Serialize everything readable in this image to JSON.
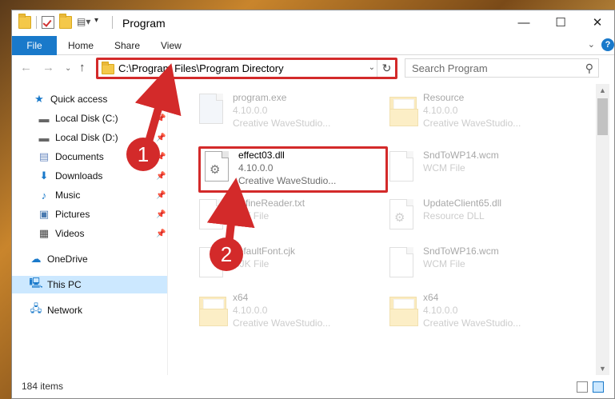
{
  "window": {
    "title": "Program",
    "controls": {
      "minimize": "—",
      "maximize": "☐",
      "close": "✕"
    }
  },
  "ribbon": {
    "tabs": [
      "File",
      "Home",
      "Share",
      "View"
    ],
    "help": "?"
  },
  "nav": {
    "address": "C:\\Program Files\\Program Directory",
    "search_placeholder": "Search Program"
  },
  "sidebar": {
    "items": [
      {
        "label": "Quick access",
        "icon": "star-icon",
        "pinned": false
      },
      {
        "label": "Local Disk (C:)",
        "icon": "drive-icon",
        "pinned": true
      },
      {
        "label": "Local Disk (D:)",
        "icon": "drive-icon",
        "pinned": true
      },
      {
        "label": "Documents",
        "icon": "documents-icon",
        "pinned": true
      },
      {
        "label": "Downloads",
        "icon": "download-icon",
        "pinned": true
      },
      {
        "label": "Music",
        "icon": "music-icon",
        "pinned": true
      },
      {
        "label": "Pictures",
        "icon": "pictures-icon",
        "pinned": true
      },
      {
        "label": "Videos",
        "icon": "video-icon",
        "pinned": true
      },
      {
        "label": "OneDrive",
        "icon": "cloud-icon",
        "pinned": false
      },
      {
        "label": "This PC",
        "icon": "computer-icon",
        "pinned": false,
        "selected": true
      },
      {
        "label": "Network",
        "icon": "network-icon",
        "pinned": false
      }
    ]
  },
  "files": [
    {
      "name": "program.exe",
      "line1": "4.10.0.0",
      "line2": "Creative WaveStudio...",
      "icon": "exe-icon",
      "faded": true
    },
    {
      "name": "Resource",
      "line1": "4.10.0.0",
      "line2": "Creative WaveStudio...",
      "icon": "folder-icon",
      "faded": true
    },
    {
      "name": "effect03.dll",
      "line1": "4.10.0.0",
      "line2": "Creative WaveStudio...",
      "icon": "dll-gear-icon",
      "faded": false
    },
    {
      "name": "SndToWP14.wcm",
      "line1": "WCM File",
      "line2": "",
      "icon": "file-icon",
      "faded": true
    },
    {
      "name": "fip.fineReader.txt",
      "display": "fip.fineReader.txt",
      "line1": "TXT File",
      "line2": "",
      "icon": "file-icon",
      "faded": true
    },
    {
      "name": "UpdateClient65.dll",
      "line1": "Resource DLL",
      "line2": "",
      "icon": "dll-gear-icon",
      "faded": true
    },
    {
      "name": "defaultFont.cjk",
      "line1": "CJK File",
      "line2": "",
      "icon": "file-icon",
      "faded": true
    },
    {
      "name": "SndToWP16.wcm",
      "line1": "WCM File",
      "line2": "",
      "icon": "file-icon",
      "faded": true
    },
    {
      "name": "x64",
      "line1": "4.10.0.0",
      "line2": "Creative WaveStudio...",
      "icon": "folder-icon",
      "faded": true
    },
    {
      "name": "x64",
      "line1": "4.10.0.0",
      "line2": "Creative WaveStudio...",
      "icon": "folder-icon",
      "faded": true
    }
  ],
  "status": {
    "count": "184 items"
  },
  "annotations": {
    "marker1": "1",
    "marker2": "2"
  },
  "colors": {
    "accent": "#1979ca",
    "highlight": "#d32a2a",
    "selected": "#cce8ff"
  }
}
